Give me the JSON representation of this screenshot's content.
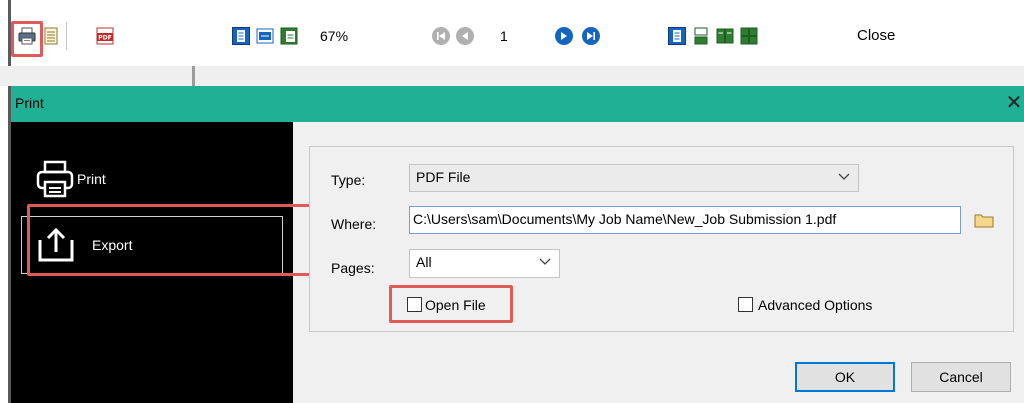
{
  "toolbar": {
    "zoom": "67%",
    "page_number": "1",
    "close_label": "Close",
    "pdf_icon_text": "PDF"
  },
  "dialog": {
    "title": "Print",
    "close_glyph": "✕",
    "sidebar": [
      {
        "label": "Print",
        "icon": "printer-icon"
      },
      {
        "label": "Export",
        "icon": "export-upload-icon"
      }
    ],
    "form": {
      "type_label": "Type:",
      "type_value": "PDF File",
      "where_label": "Where:",
      "where_value": "C:\\Users\\sam\\Documents\\My Job Name\\New_Job Submission 1.pdf",
      "pages_label": "Pages:",
      "pages_value": "All",
      "open_file_label": "Open File",
      "advanced_label": "Advanced Options"
    },
    "buttons": {
      "ok": "OK",
      "cancel": "Cancel"
    }
  },
  "colors": {
    "titlebar": "#1fb095",
    "sidebar": "#000000",
    "highlight": "#e05a5a",
    "toolbar_blue": "#1565c0",
    "folder": "#f5d68c"
  }
}
